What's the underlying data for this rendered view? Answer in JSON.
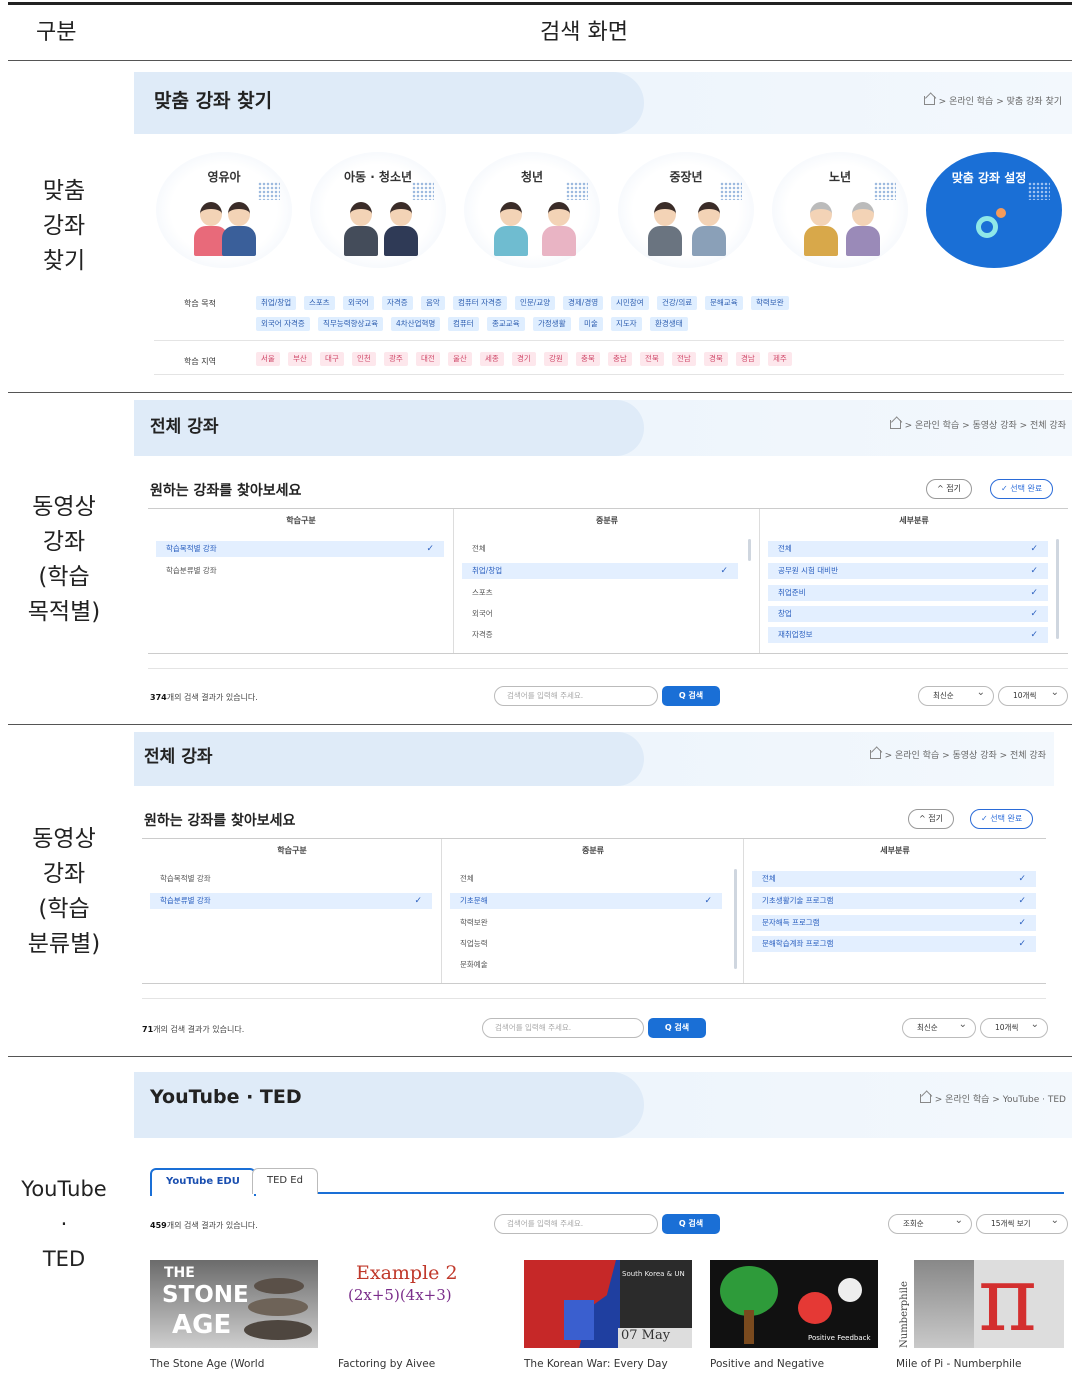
{
  "table": {
    "col_category": "구분",
    "col_screen": "검색 화면"
  },
  "rows": [
    {
      "label": [
        "맞춤",
        "강좌",
        "찾기"
      ]
    },
    {
      "label": [
        "동영상",
        "강좌",
        "(학습",
        "목적별)"
      ]
    },
    {
      "label": [
        "동영상",
        "강좌",
        "(학습",
        "분류별)"
      ]
    },
    {
      "label": [
        "YouTube",
        "·",
        "TED"
      ]
    }
  ],
  "custom": {
    "title": "맞춤 강좌 찾기",
    "breadcrumb": "> 온라인 학습 > 맞춤 강좌 찾기",
    "circles": [
      "영유아",
      "아동 · 청소년",
      "청년",
      "중장년",
      "노년"
    ],
    "custom_setting": "맞춤 강좌 설정",
    "purpose_label": "학습 목적",
    "region_label": "학습 지역",
    "purpose_tags_1": [
      "취업/창업",
      "스포츠",
      "외국어",
      "자격증",
      "음악",
      "컴퓨터 자격증",
      "인문/교양",
      "경제/경영",
      "시민참여",
      "건강/의료",
      "문해교육",
      "학력보완"
    ],
    "purpose_tags_2": [
      "외국어 자격증",
      "직무능력향상교육",
      "4차산업혁명",
      "컴퓨터",
      "종교교육",
      "가정생활",
      "미술",
      "지도자",
      "환경생태"
    ],
    "region_tags": [
      "서울",
      "부산",
      "대구",
      "인천",
      "광주",
      "대전",
      "울산",
      "세종",
      "경기",
      "강원",
      "충북",
      "충남",
      "전북",
      "전남",
      "경북",
      "경남",
      "제주"
    ]
  },
  "purpose": {
    "title": "전체 강좌",
    "breadcrumb": "> 온라인 학습 > 동영상 강좌 > 전체 강좌",
    "heading": "원하는 강좌를 찾아보세요",
    "fold": "^ 접기",
    "done": "✓ 선택 완료",
    "col1": "학습구분",
    "col2": "중분류",
    "col3": "세부분류",
    "col1_items": [
      "학습목적별 강좌",
      "학습분류별 강좌"
    ],
    "col2_items": [
      "전체",
      "취업/창업",
      "스포츠",
      "외국어",
      "자격증"
    ],
    "col3_items": [
      "전체",
      "공무원 시험 대비반",
      "취업준비",
      "창업",
      "재취업정보"
    ],
    "count_num": "374",
    "count_text": "개의 검색 결과가 있습니다.",
    "search_placeholder": "검색어를 입력해 주세요.",
    "search_btn": "Q 검색",
    "sort": "최신순",
    "per_page": "10개씩"
  },
  "classify": {
    "title": "전체 강좌",
    "breadcrumb": "> 온라인 학습 > 동영상 강좌 > 전체 강좌",
    "heading": "원하는 강좌를 찾아보세요",
    "fold": "^ 접기",
    "done": "✓ 선택 완료",
    "col1": "학습구분",
    "col2": "중분류",
    "col3": "세부분류",
    "col1_items": [
      "학습목적별 강좌",
      "학습분류별 강좌"
    ],
    "col2_items": [
      "전체",
      "기초문해",
      "학력보완",
      "직업능력",
      "문화예술"
    ],
    "col3_items": [
      "전체",
      "기초생활기술 프로그램",
      "문자해득 프로그램",
      "문해학습계좌 프로그램"
    ],
    "count_num": "71",
    "count_text": "개의 검색 결과가 있습니다.",
    "search_placeholder": "검색어를 입력해 주세요.",
    "search_btn": "Q 검색",
    "sort": "최신순",
    "per_page": "10개씩"
  },
  "yt": {
    "title": "YouTube · TED",
    "breadcrumb": "> 온라인 학습 > YouTube · TED",
    "tab1": "YouTube EDU",
    "tab2": "TED Ed",
    "count_num": "459",
    "count_text": "개의 검색 결과가 있습니다.",
    "search_placeholder": "검색어를 입력해 주세요.",
    "search_btn": "Q 검색",
    "sort": "조회순",
    "per_page": "15개씩 보기",
    "thumb1_text": [
      "THE",
      "STONE",
      "AGE"
    ],
    "thumb2_text": [
      "Example 2",
      "(2x+5)(4x+3)"
    ],
    "thumb3_text": [
      "South Korea & UN",
      "07 May"
    ],
    "thumb4_text": [
      "Positive Feedback"
    ],
    "thumb5_text": [
      "Numberphile"
    ],
    "captions": [
      "The Stone Age (World",
      "Factoring by Aivee",
      "The Korean War: Every Day",
      "Positive and Negative",
      "Mile of Pi - Numberphile"
    ]
  },
  "colors": {
    "accent": "#1a6fd6",
    "tag_blue": "#dfeeff",
    "tag_pink": "#fde7ec"
  }
}
